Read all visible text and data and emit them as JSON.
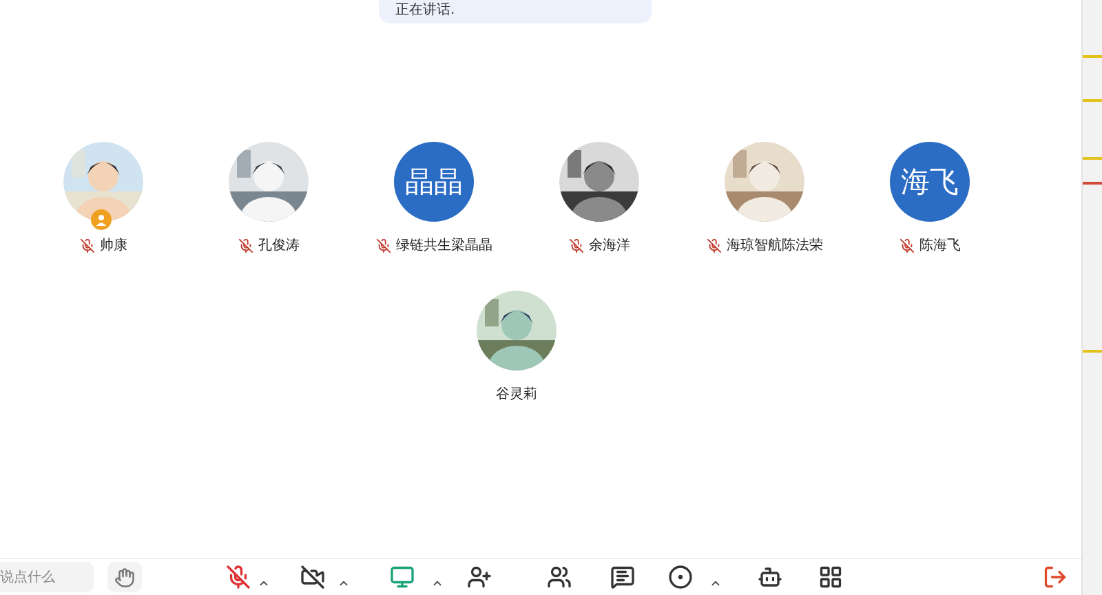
{
  "speaking_bubble": {
    "text": "正在讲话."
  },
  "participants": [
    {
      "name": "帅康",
      "muted": true,
      "host": true
    },
    {
      "name": "孔俊涛",
      "muted": true,
      "host": false
    },
    {
      "name": "绿链共生梁晶晶",
      "avatar": {
        "kind": "text",
        "text": "晶晶"
      },
      "muted": true,
      "host": false
    },
    {
      "name": "余海洋",
      "muted": true,
      "host": false
    },
    {
      "name": "海琼智航陈法荣",
      "muted": true,
      "host": false
    },
    {
      "name": "陈海飞",
      "avatar": {
        "kind": "text",
        "text": "海飞"
      },
      "muted": true,
      "host": false
    },
    {
      "name": "谷灵莉",
      "muted": false,
      "host": false
    }
  ],
  "toolbar": {
    "chat_input": {
      "placeholder": "说点什么"
    },
    "buttons": [
      {
        "kind": "hand"
      },
      {
        "kind": "mic-off",
        "caret": true
      },
      {
        "kind": "video-off",
        "caret": true
      },
      {
        "kind": "share",
        "caret": true
      },
      {
        "kind": "invite",
        "caret": false
      },
      {
        "kind": "members",
        "caret": false
      },
      {
        "kind": "chat",
        "caret": false
      },
      {
        "kind": "record",
        "caret": true
      },
      {
        "kind": "assistant",
        "caret": false
      },
      {
        "kind": "apps",
        "caret": false
      },
      {
        "kind": "leave",
        "caret": false
      }
    ]
  }
}
